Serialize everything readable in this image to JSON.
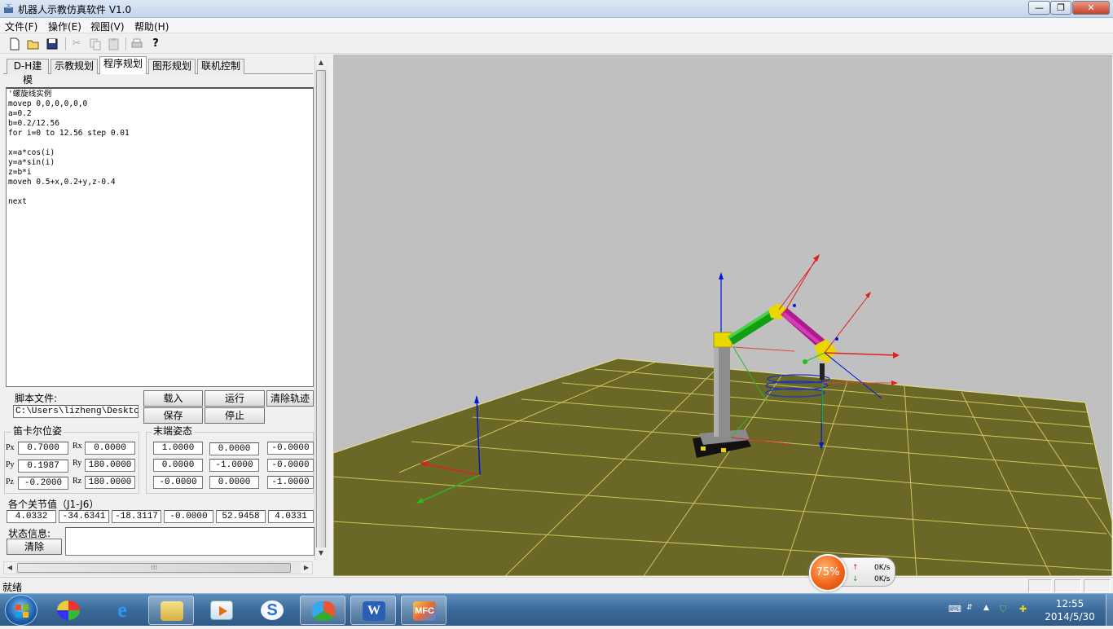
{
  "window": {
    "title": "机器人示教仿真软件 V1.0",
    "minimize": "—",
    "restore": "❐",
    "close": "✕"
  },
  "menu": [
    "文件(F)",
    "操作(E)",
    "视图(V)",
    "帮助(H)"
  ],
  "toolbar": {
    "icons": [
      "new-icon",
      "open-icon",
      "save-icon",
      "cut-icon",
      "copy-icon",
      "paste-icon",
      "print-icon",
      "help-icon"
    ]
  },
  "tabs": [
    "D-H建模",
    "示教规划",
    "程序规划",
    "图形规划",
    "联机控制"
  ],
  "active_tab": "程序规划",
  "script": "'螺旋线实例\nmovep 0,0,0,0,0,0\na=0.2\nb=0.2/12.56\nfor i=0 to 12.56 step 0.01\n\nx=a*cos(i)\ny=a*sin(i)\nz=b*i\nmoveh 0.5+x,0.2+y,z-0.4\n\nnext",
  "script_file": {
    "label": "脚本文件:",
    "path": "C:\\Users\\lizheng\\Desktop\\"
  },
  "buttons": {
    "load": "载入",
    "run": "运行",
    "clear_track": "清除轨迹",
    "save": "保存",
    "stop": "停止",
    "clear": "清除"
  },
  "cartesian": {
    "title": "笛卡尔位姿",
    "px_label": "Px",
    "px": "0.7000",
    "py_label": "Py",
    "py": "0.1987",
    "pz_label": "Pz",
    "pz": "-0.2000",
    "rx_label": "Rx",
    "rx": "0.0000",
    "ry_label": "Ry",
    "ry": "180.0000",
    "rz_label": "Rz",
    "rz": "180.0000"
  },
  "end_pose": {
    "title": "末端姿态",
    "m": [
      [
        "1.0000",
        "0.0000",
        "-0.0000"
      ],
      [
        "0.0000",
        "-1.0000",
        "-0.0000"
      ],
      [
        "-0.0000",
        "0.0000",
        "-1.0000"
      ]
    ]
  },
  "joints": {
    "title": "各个关节值（J1-J6）",
    "values": [
      "4.0332",
      "-34.6341",
      "-18.3117",
      "-0.0000",
      "52.9458",
      "4.0331"
    ]
  },
  "status": {
    "label": "状态信息:",
    "text": ""
  },
  "hscroll_grip": "⁞⁞⁞",
  "statusbar": {
    "text": "就绪"
  },
  "speed_widget": {
    "percent": "75%",
    "up": "0K/s",
    "down": "0K/s"
  },
  "clock": {
    "time": "12:55",
    "date": "2014/5/30"
  },
  "taskbar_apps": [
    "start-orb",
    "colorful-app-icon",
    "internet-explorer-icon",
    "file-explorer-icon",
    "media-player-icon",
    "sogou-icon",
    "chat-app-icon",
    "word-icon",
    "mfc-app-icon"
  ]
}
